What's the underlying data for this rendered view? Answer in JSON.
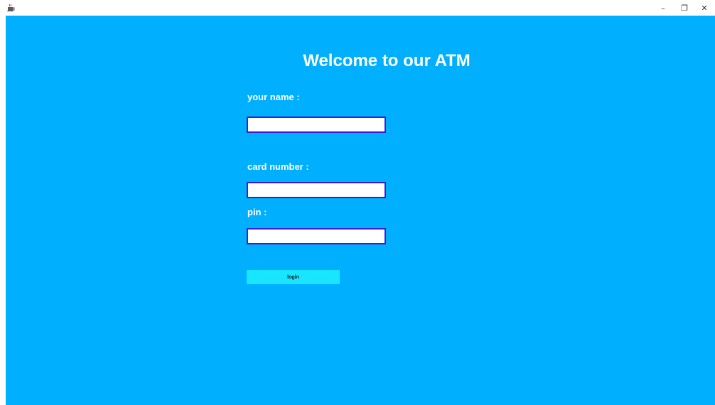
{
  "window": {
    "app_icon": "java-cup-icon",
    "minimize_glyph": "–",
    "maximize_glyph": "❐",
    "close_glyph": "✕"
  },
  "colors": {
    "background": "#00b0ff",
    "text": "#ffffff",
    "field_border": "#3a1cd8",
    "button": "#1ae5ff"
  },
  "form": {
    "title": "Welcome to our ATM",
    "name_label": "your name :",
    "name_value": "",
    "card_label": "card number :",
    "card_value": "",
    "pin_label": "pin :",
    "pin_value": "",
    "login_label": "login"
  }
}
